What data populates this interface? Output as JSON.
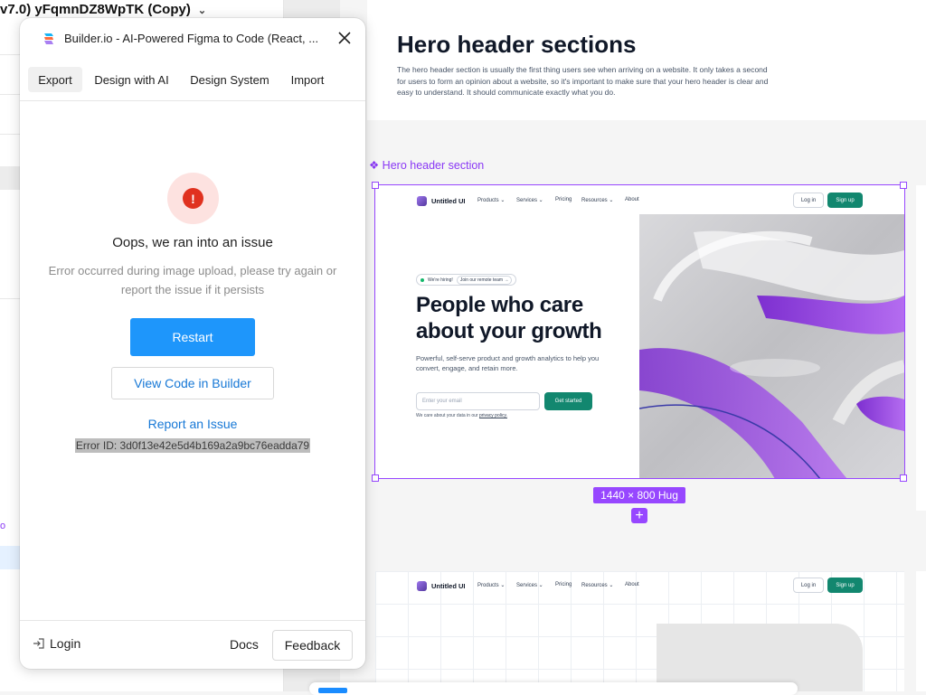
{
  "figma": {
    "file_title": "v7.0) yFqmnDZ8WpTK (Copy)",
    "doc": {
      "title": "Hero header sections",
      "description": "The hero header section is usually the first thing users see when arriving on a website. It only takes a second for users to form an opinion about a website, so it's important to make sure that your hero header is clear and easy to understand. It should communicate exactly what you do."
    },
    "frame_label": "❖ Hero header section",
    "size_badge": "1440 × 800 Hug",
    "add_symbol": "+",
    "selection_color": "#9747ff"
  },
  "hero": {
    "brand": "Untitled UI",
    "nav": [
      "Products ⌄",
      "Services ⌄",
      "Pricing",
      "Resources ⌄",
      "About"
    ],
    "login": "Log in",
    "signup": "Sign up",
    "pill_left": "We're hiring!",
    "pill_right": "Join our remote team →",
    "heading": "People who care about your growth",
    "subheading": "Powerful, self-serve product and growth analytics to help you convert, engage, and retain more.",
    "email_placeholder": "Enter your email",
    "cta": "Get started",
    "privacy_prefix": "We care about your data in our ",
    "privacy_link": "privacy policy.",
    "accent": "#12876f"
  },
  "hero2": {
    "brand": "Untitled UI",
    "nav": [
      "Products ⌄",
      "Services ⌄",
      "Pricing",
      "Resources ⌄",
      "About"
    ],
    "login": "Log in",
    "signup": "Sign up"
  },
  "plugin": {
    "title": "Builder.io - AI-Powered Figma to Code (React, ...",
    "close_icon": "close-icon",
    "tabs": [
      "Export",
      "Design with AI",
      "Design System",
      "Import"
    ],
    "active_tab": "Export",
    "error": {
      "icon": "!",
      "title": "Oops, we ran into an issue",
      "message": "Error occurred during image upload, please try again or report the issue if it persists"
    },
    "restart_label": "Restart",
    "view_code_label": "View Code in Builder",
    "report_label": "Report an Issue",
    "error_id": "Error ID: 3d0f13e42e5d4b169a2a9bc76eadda79",
    "footer": {
      "login": "Login",
      "docs": "Docs",
      "feedback": "Feedback"
    },
    "primary_color": "#1e96fb",
    "link_color": "#1778d6",
    "error_color": "#e0311f"
  }
}
